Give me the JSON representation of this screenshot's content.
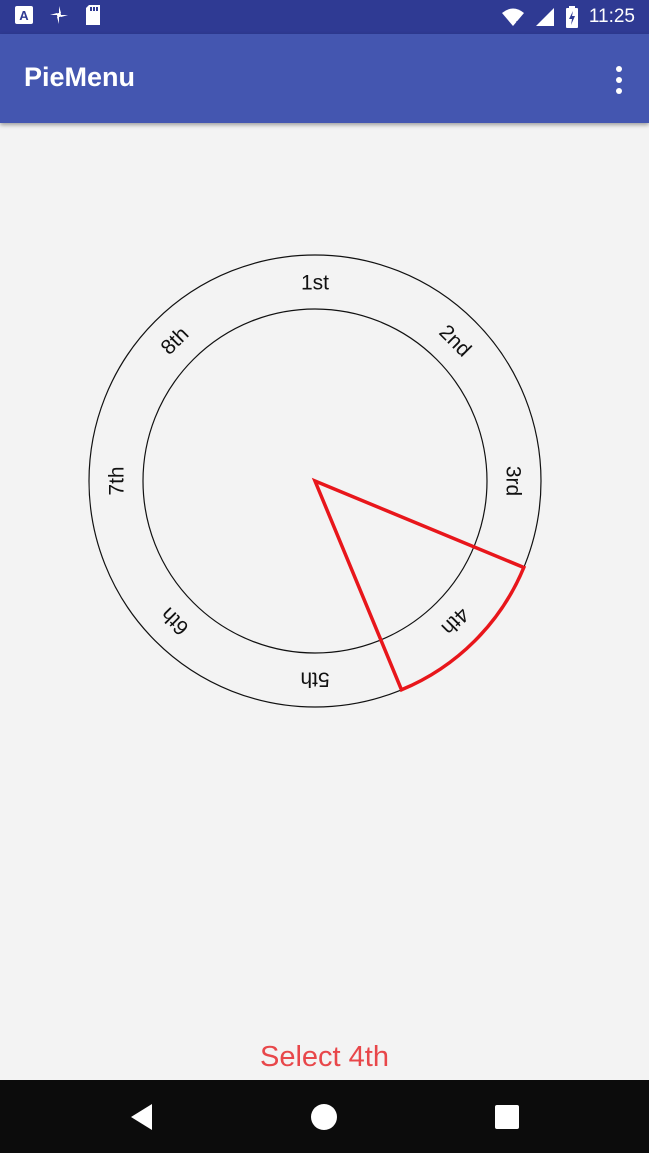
{
  "status_bar": {
    "time": "11:25"
  },
  "app_bar": {
    "title": "PieMenu"
  },
  "pie_menu": {
    "items": [
      "1st",
      "2nd",
      "3rd",
      "4th",
      "5th",
      "6th",
      "7th",
      "8th"
    ],
    "selected_index": 3,
    "selected_color": "#e8161b"
  },
  "status_text": "Select 4th"
}
